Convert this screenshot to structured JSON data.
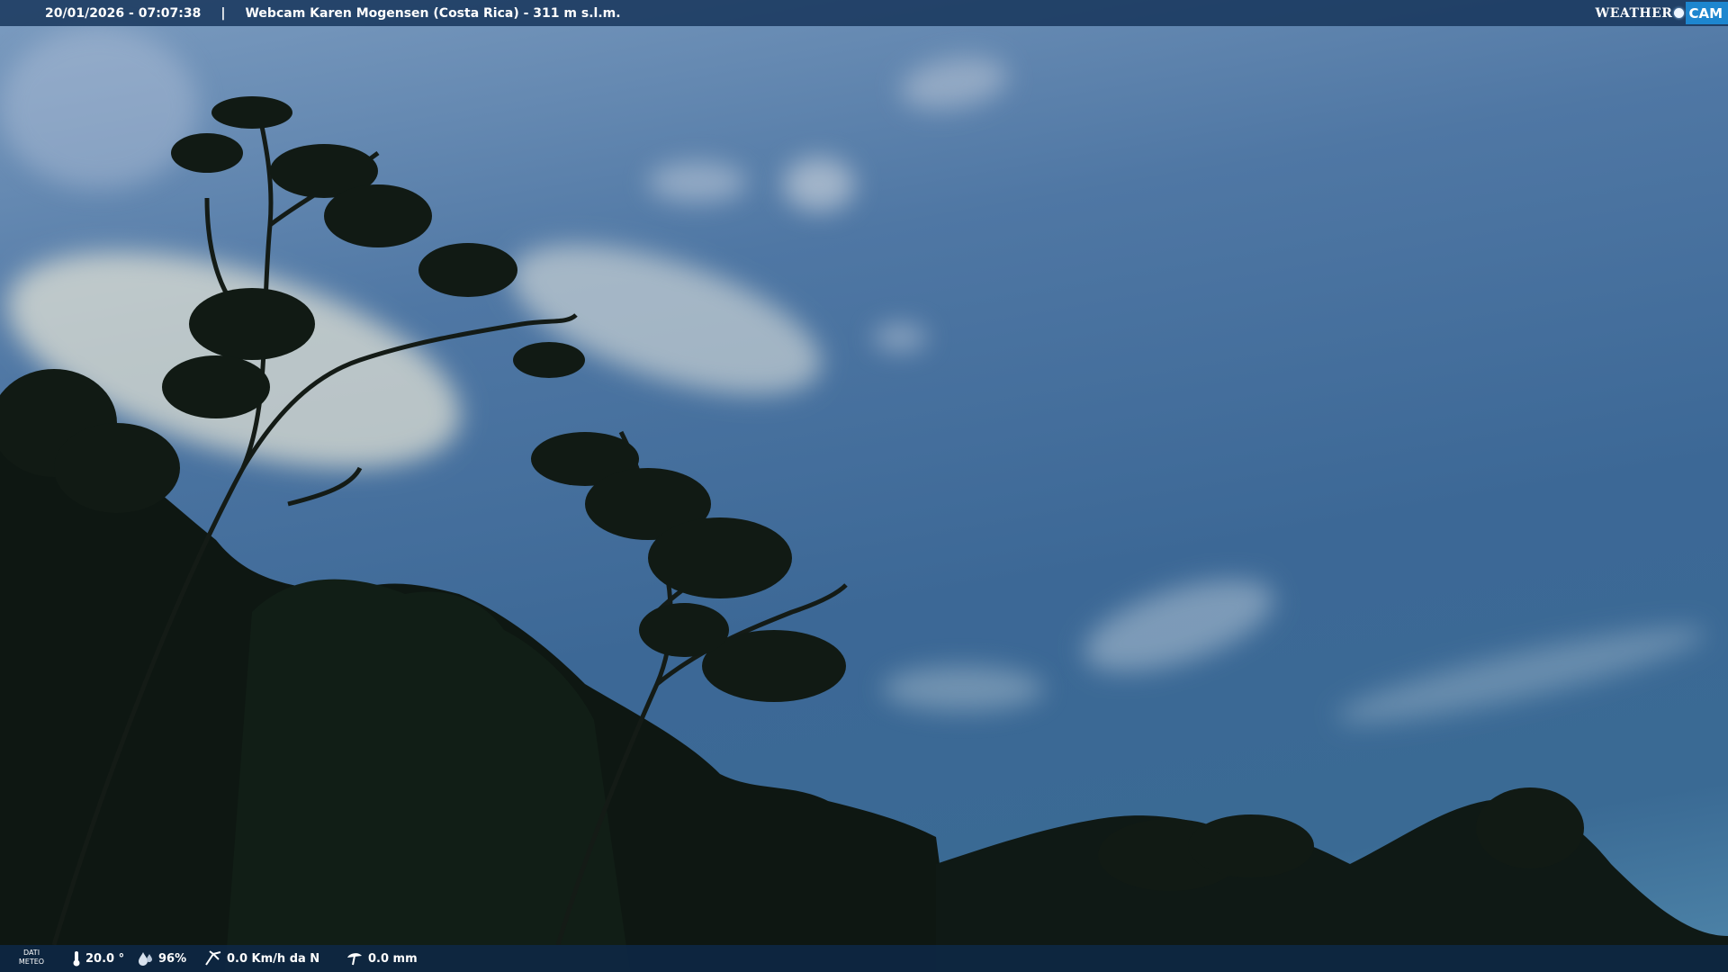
{
  "header": {
    "datetime": "20/01/2026 - 07:07:38",
    "separator": "|",
    "title": "Webcam Karen Mogensen (Costa Rica) - 311 m s.l.m."
  },
  "logo": {
    "word1": "WEATHER",
    "word2": "CAM",
    "accent": "#1d86cf"
  },
  "weather": {
    "label_line1": "DATI",
    "label_line2": "METEO",
    "temperature": "20.0 °",
    "humidity": "96%",
    "wind": "0.0 Km/h da N",
    "rain": "0.0 mm",
    "icons": [
      "thermometer-icon",
      "humidity-drop-icon",
      "wind-icon",
      "rain-gauge-icon"
    ]
  },
  "colors": {
    "sky_top": "#7c9cc0",
    "sky_mid": "#3c6896",
    "bar_bg": "#143258",
    "vegetation": "#0f1a14"
  }
}
